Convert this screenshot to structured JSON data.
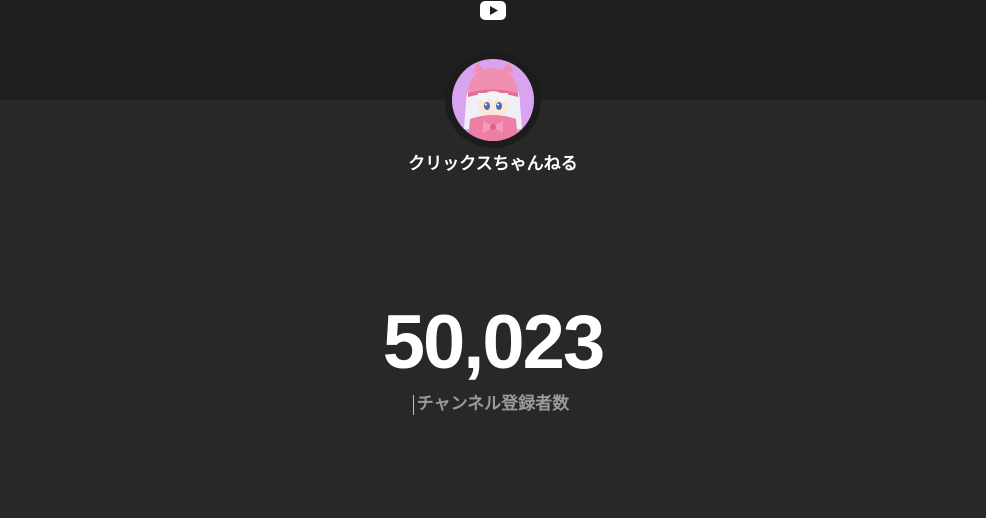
{
  "header": {
    "logo_icon": "youtube-play-icon",
    "logo_color": "#ffffff"
  },
  "channel": {
    "avatar_icon": "anime-girl-avatar",
    "name": "クリックスちゃんねる"
  },
  "stats": {
    "subscriber_count": "50,023",
    "subscriber_label": "チャンネル登録者数"
  },
  "colors": {
    "background": "#282828",
    "header_band": "#1f1f1f",
    "primary_text": "#ffffff",
    "secondary_text": "#9a9a9a"
  }
}
